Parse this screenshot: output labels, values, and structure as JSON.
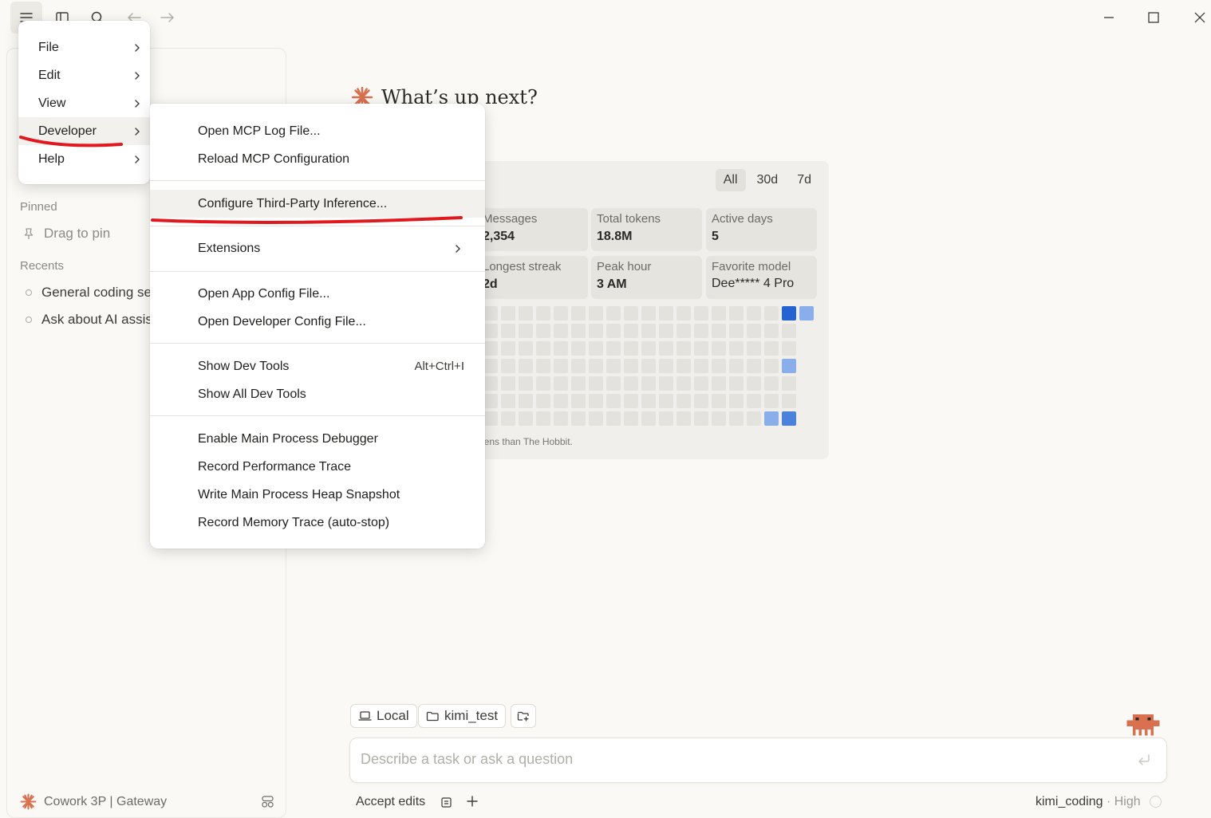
{
  "toolbar": {
    "icons": [
      "hamburger-menu-icon",
      "sidebar-toggle-icon",
      "search-icon",
      "back-arrow-icon",
      "forward-arrow-icon"
    ]
  },
  "window_controls": [
    "minimize-icon",
    "maximize-icon",
    "close-icon"
  ],
  "sidebar": {
    "pinned_label": "Pinned",
    "drag_to_pin": "Drag to pin",
    "recents_label": "Recents",
    "recents": [
      "General coding se",
      "Ask about AI assis"
    ],
    "footer_label": "Cowork 3P | Gateway"
  },
  "main": {
    "heading": "What’s up next?",
    "ranges": [
      "All",
      "30d",
      "7d"
    ],
    "selected_range": "All",
    "stats": {
      "messages_label": "Messages",
      "messages_value": "2,354",
      "total_tokens_label": "Total tokens",
      "total_tokens_value": "18.8M",
      "active_days_label": "Active days",
      "active_days_value": "5",
      "longest_streak_label": "Longest streak",
      "longest_streak_value": "2d",
      "peak_hour_label": "Peak hour",
      "peak_hour_value": "3 AM",
      "favorite_model_label": "Favorite model",
      "favorite_model_value": "Dee***** 4 Pro"
    },
    "fun_fact": "okens than The Hobbit.",
    "heatmap_colors": {
      "empty": "#e3e2dd",
      "light": "#8aaeea",
      "medium": "#4a82db",
      "dark": "#2563d0"
    }
  },
  "composer": {
    "env_label": "Local",
    "folder_label": "kimi_test",
    "placeholder": "Describe a task or ask a question",
    "accept_edits": "Accept edits",
    "model": "kimi_coding",
    "effort": "· High"
  },
  "menu": {
    "items": [
      "File",
      "Edit",
      "View",
      "Developer",
      "Help"
    ],
    "highlighted": "Developer"
  },
  "developer_menu": {
    "open_mcp_log": "Open MCP Log File...",
    "reload_mcp": "Reload MCP Configuration",
    "configure_inference": "Configure Third-Party Inference...",
    "extensions": "Extensions",
    "open_app_config": "Open App Config File...",
    "open_dev_config": "Open Developer Config File...",
    "show_dev_tools": "Show Dev Tools",
    "show_dev_tools_shortcut": "Alt+Ctrl+I",
    "show_all_dev_tools": "Show All Dev Tools",
    "enable_debugger": "Enable Main Process Debugger",
    "record_perf": "Record Performance Trace",
    "heap_snapshot": "Write Main Process Heap Snapshot",
    "memory_trace": "Record Memory Trace (auto-stop)"
  },
  "colors": {
    "accent": "#d9704f",
    "annotation_red": "#e0191f"
  }
}
